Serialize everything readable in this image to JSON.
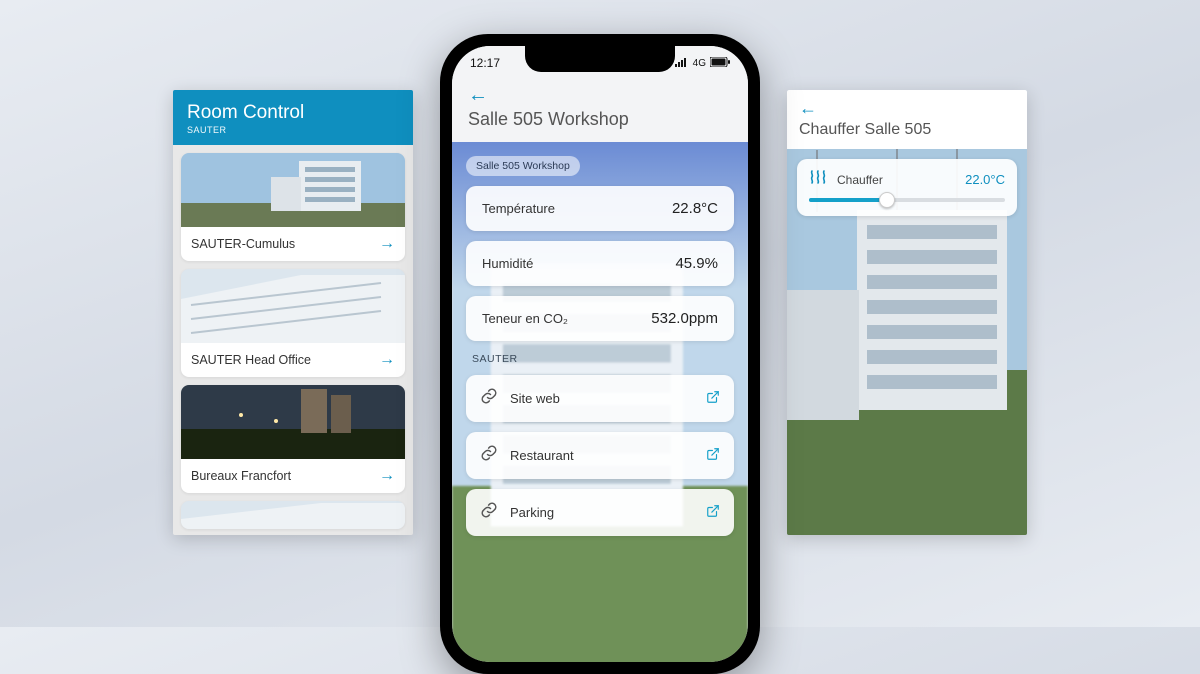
{
  "left": {
    "title": "Room Control",
    "brand": "SAUTER",
    "items": [
      {
        "name": "SAUTER-Cumulus"
      },
      {
        "name": "SAUTER Head Office"
      },
      {
        "name": "Bureaux Francfort"
      }
    ]
  },
  "center": {
    "status_time": "12:17",
    "status_net": "4G",
    "title": "Salle 505 Workshop",
    "chip": "Salle 505 Workshop",
    "metrics": [
      {
        "label": "Température",
        "value": "22.8°C"
      },
      {
        "label": "Humidité",
        "value": "45.9%"
      },
      {
        "label": "Teneur en CO₂",
        "value": "532.0ppm"
      }
    ],
    "section": "SAUTER",
    "links": [
      {
        "label": "Site web"
      },
      {
        "label": "Restaurant"
      },
      {
        "label": "Parking"
      }
    ]
  },
  "right": {
    "title": "Chauffer Salle 505",
    "slider": {
      "label": "Chauffer",
      "value": "22.0°C"
    }
  }
}
